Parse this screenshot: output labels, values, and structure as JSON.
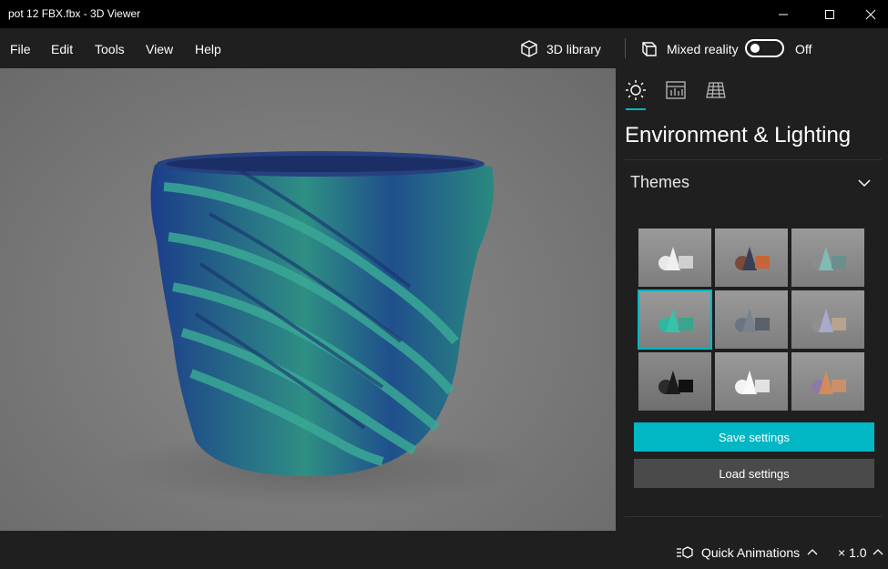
{
  "window": {
    "title": "pot 12 FBX.fbx - 3D Viewer"
  },
  "menu": {
    "file": "File",
    "edit": "Edit",
    "tools": "Tools",
    "view": "View",
    "help": "Help"
  },
  "toolbar": {
    "library_label": "3D library",
    "mixed_reality_label": "Mixed reality",
    "toggle_state": "Off"
  },
  "panel": {
    "tabs": [
      "sun-icon",
      "stats-icon",
      "grid-icon"
    ],
    "title": "Environment & Lighting",
    "themes_label": "Themes",
    "themes": [
      {
        "name": "theme-1",
        "selected": false,
        "colors": [
          "#e8e8e8",
          "#cfcfcf"
        ]
      },
      {
        "name": "theme-2",
        "selected": false,
        "colors": [
          "#3a3f55",
          "#c8643a"
        ]
      },
      {
        "name": "theme-3",
        "selected": false,
        "colors": [
          "#7fbcb6",
          "#6a8f8c"
        ]
      },
      {
        "name": "theme-4",
        "selected": true,
        "colors": [
          "#2fb8a0",
          "#3aa48e"
        ]
      },
      {
        "name": "theme-5",
        "selected": false,
        "colors": [
          "#6b7480",
          "#596069"
        ]
      },
      {
        "name": "theme-6",
        "selected": false,
        "colors": [
          "#a9a9c9",
          "#b8a38f"
        ]
      },
      {
        "name": "theme-7",
        "selected": false,
        "colors": [
          "#1b1b1b",
          "#2b2b2b"
        ]
      },
      {
        "name": "theme-8",
        "selected": false,
        "colors": [
          "#f2f2f2",
          "#e2e2e2"
        ]
      },
      {
        "name": "theme-9",
        "selected": false,
        "colors": [
          "#d38b5a",
          "#8e7aa8"
        ]
      }
    ],
    "save_label": "Save settings",
    "load_label": "Load settings"
  },
  "status": {
    "quick_animations_label": "Quick Animations",
    "speed": "× 1.0"
  },
  "colors": {
    "accent": "#00b7c3",
    "pot_green": "#2e8f84",
    "pot_blue": "#1c3d8a"
  }
}
